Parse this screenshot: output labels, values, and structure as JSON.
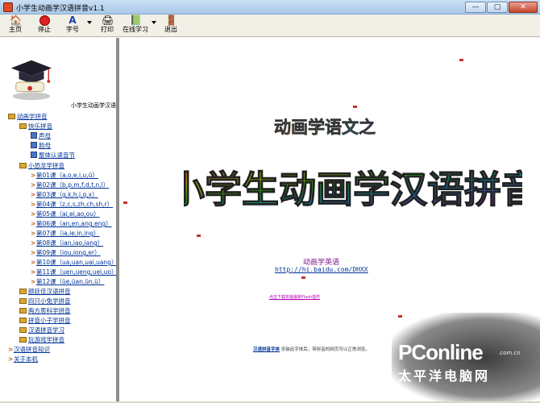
{
  "window": {
    "title": "小学生动画学汉语拼音v1.1",
    "minimize_label": "—",
    "maximize_label": "▢",
    "close_label": "✕"
  },
  "toolbar": {
    "home": "主页",
    "stop": "停止",
    "font": "字号",
    "print": "打印",
    "online": "在线学习",
    "exit": "退出"
  },
  "sidebar": {
    "title": "小学生动画学汉语拼音",
    "root": "动画学拼音",
    "happy_group": "快乐拼音",
    "happy_items": [
      "声母",
      "韵母",
      "整体认读音节"
    ],
    "dino_group": "小恐龙学拼音",
    "lessons": [
      "第01课（a,o,e,i,u,ü）",
      "第02课（b,p,m,f,d,t,n,l）",
      "第03课（g,k,h,j,q,x）",
      "第04课（z,c,s,zh,ch,sh,r）",
      "第05课（ai,ei,ao,ou）",
      "第06课（an,en,ang,eng）",
      "第07课（ia,ie,in,ing）",
      "第08课（ian,iao,iang）",
      "第09课（iou,iong,er）",
      "第10课（ua,uan,uai,uang）",
      "第11课（uen,ueng,uei,uo）",
      "第12课（üe,üan,ün,ü）"
    ],
    "more_groups": [
      "颜廷佳汉语拼音",
      "四只小兔学拼音",
      "两方思科学拼音",
      "拼音小子学拼音",
      "汉语拼音学习",
      "玩游戏学拼音"
    ],
    "bottom_links": [
      "汉语拼音知识",
      "关于本机"
    ]
  },
  "main": {
    "subtitle": "动画学语文之",
    "headline": "小学生动画学汉语拼音",
    "link_cn": "动画学英语",
    "link_url": "http://hi.baidu.com/DHXX",
    "flash_note": "点击下载安装最新Flash插件",
    "font_note_link": "汉语拼音字体",
    "font_note_text": "安装此字体后，带拼音的网页可以正常浏览。"
  },
  "watermark": {
    "brand": "PConline",
    "domain": ".com.cn",
    "cn": "太平洋电脑网"
  },
  "colors": {
    "link": "#003399",
    "title_gradient": [
      "#ff2a2a",
      "#ffd400",
      "#21c400",
      "#00b7ff",
      "#8a2be2"
    ]
  }
}
